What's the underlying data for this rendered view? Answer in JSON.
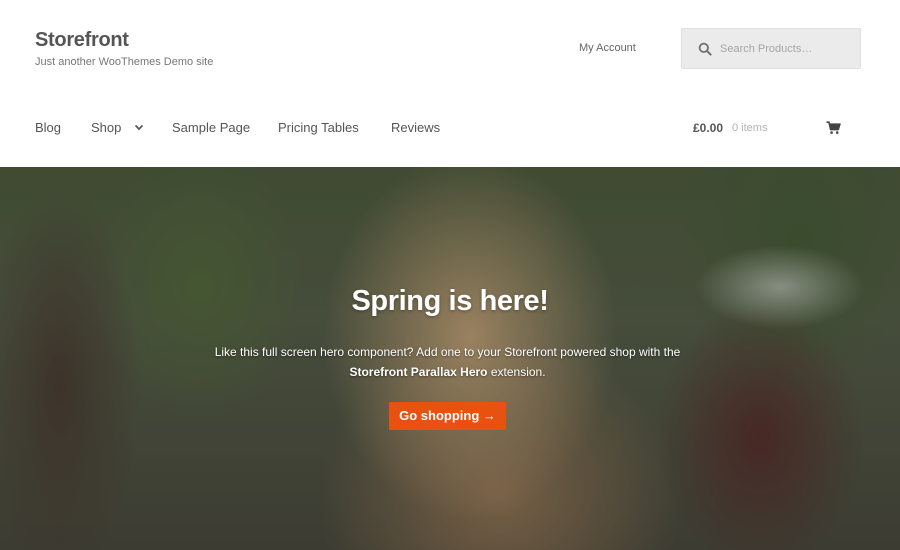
{
  "header": {
    "site_title": "Storefront",
    "tagline": "Just another WooThemes Demo site",
    "my_account": "My Account",
    "search": {
      "placeholder": "Search Products…"
    }
  },
  "nav": {
    "items": [
      {
        "label": "Blog"
      },
      {
        "label": "Shop",
        "has_dropdown": true
      },
      {
        "label": "Sample Page"
      },
      {
        "label": "Pricing Tables"
      },
      {
        "label": "Reviews"
      }
    ]
  },
  "cart": {
    "total": "£0.00",
    "count": "0 items",
    "icon": "shopping-cart-icon"
  },
  "hero": {
    "title": "Spring is here!",
    "text_before": "Like this full screen hero component? Add one to your Storefront powered shop with the",
    "text_strong": "Storefront Parallax Hero",
    "text_after": "extension.",
    "button_label": "Go shopping →",
    "button_color": "#e8510f"
  },
  "colors": {
    "accent": "#e8510f",
    "text": "#555555",
    "search_bg": "#ebebeb"
  }
}
